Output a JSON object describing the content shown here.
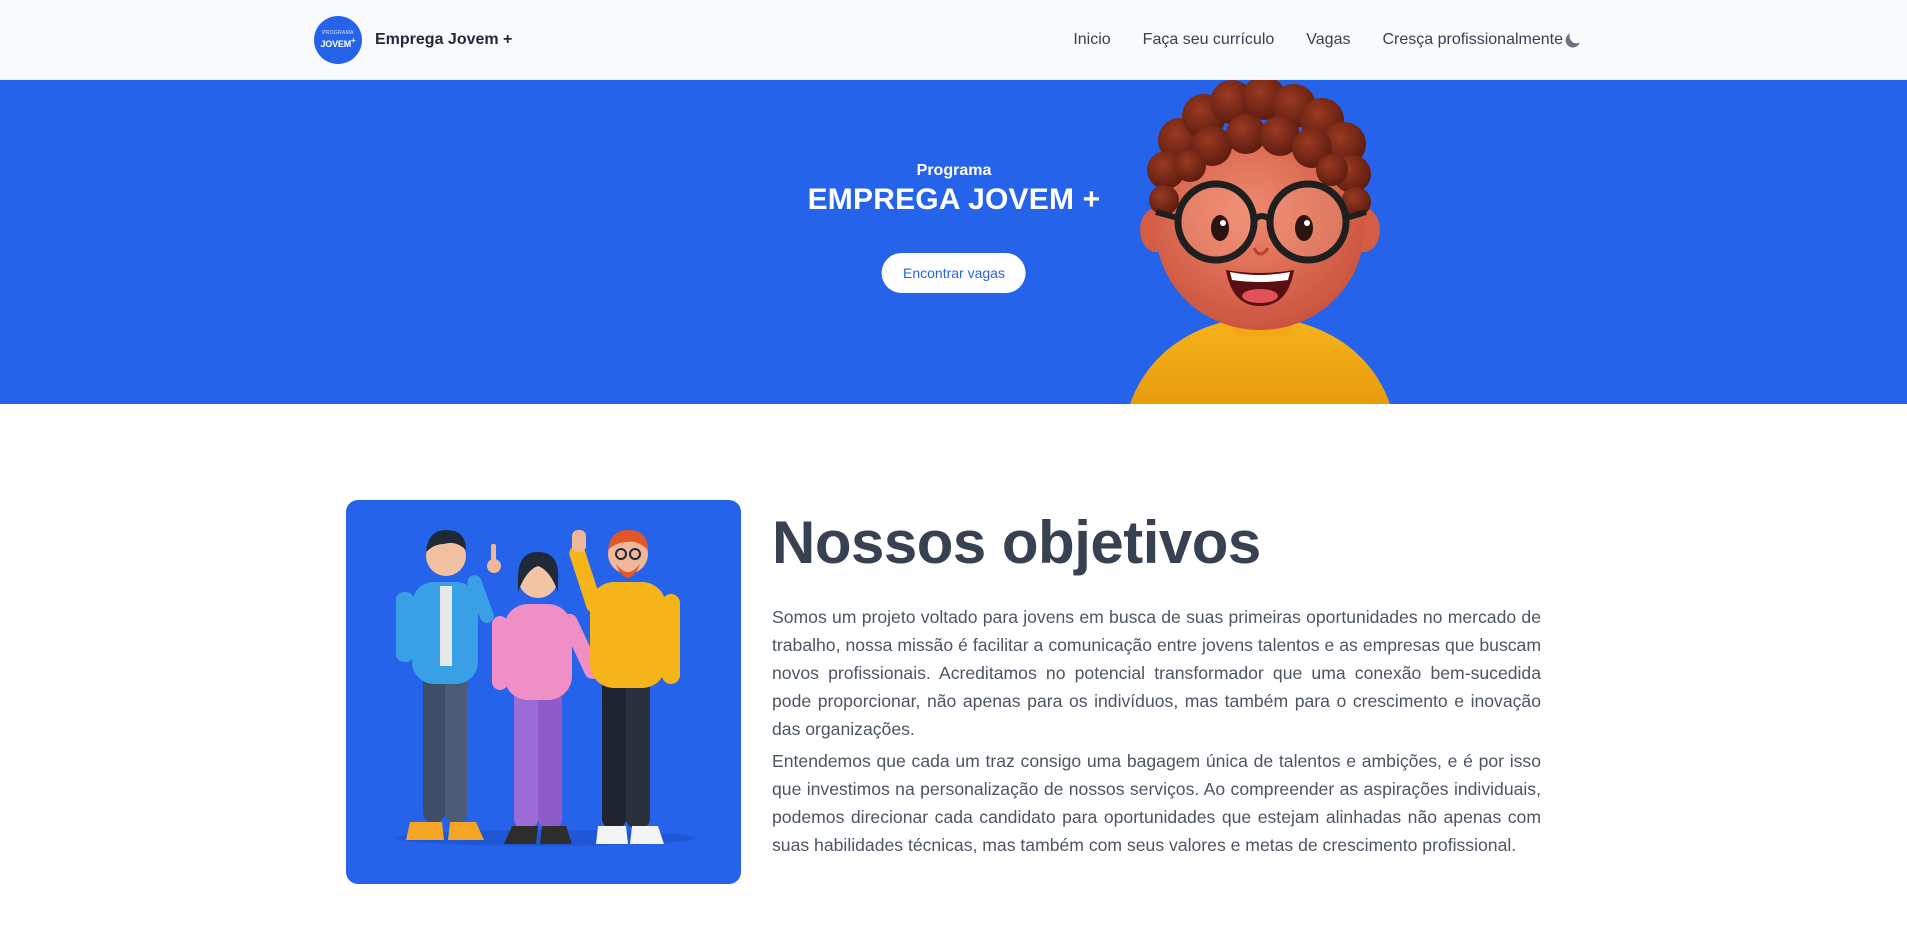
{
  "navbar": {
    "logo_small": "PROGRAMA",
    "logo_main": "JOVEM",
    "logo_sup": "+",
    "brand_name": "Emprega Jovem +",
    "links": [
      "Inicio",
      "Faça seu currículo",
      "Vagas",
      "Cresça profissionalmente"
    ],
    "theme_icon": "moon-icon"
  },
  "hero": {
    "kicker": "Programa",
    "title": "EMPREGA JOVEM +",
    "button_label": "Encontrar vagas"
  },
  "objectives": {
    "title": "Nossos objetivos",
    "paragraphs": [
      "Somos um projeto voltado para jovens em busca de suas primeiras oportunidades no mercado de trabalho, nossa missão é facilitar a comunicação entre jovens talentos e as empresas que buscam novos profissionais. Acreditamos no potencial transformador que uma conexão bem-sucedida pode proporcionar, não apenas para os indivíduos, mas também para o crescimento e inovação das organizações.",
      "Entendemos que cada um traz consigo uma bagagem única de talentos e ambições, e é por isso que investimos na personalização de nossos serviços. Ao compreender as aspirações individuais, podemos direcionar cada candidato para oportunidades que estejam alinhadas não apenas com suas habilidades técnicas, mas também com seus valores e metas de crescimento profissional."
    ]
  },
  "colors": {
    "primary": "#2563eb",
    "nav_background": "#f9fafb",
    "text_dark": "#374151"
  }
}
